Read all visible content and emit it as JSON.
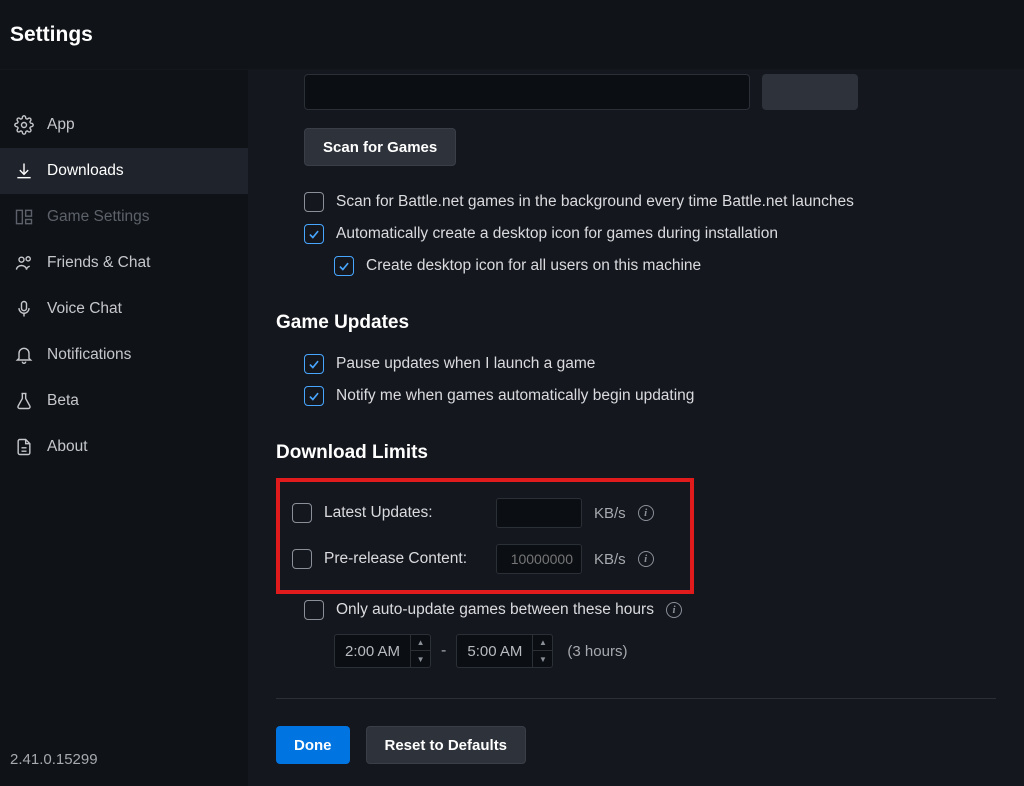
{
  "header": {
    "title": "Settings"
  },
  "sidebar": {
    "items": [
      {
        "label": "App"
      },
      {
        "label": "Downloads"
      },
      {
        "label": "Game Settings"
      },
      {
        "label": "Friends & Chat"
      },
      {
        "label": "Voice Chat"
      },
      {
        "label": "Notifications"
      },
      {
        "label": "Beta"
      },
      {
        "label": "About"
      }
    ],
    "version": "2.41.0.15299"
  },
  "scan": {
    "button": "Scan for Games",
    "background_label": "Scan for Battle.net games in the background every time Battle.net launches",
    "auto_icon_label": "Automatically create a desktop icon for games during installation",
    "all_users_label": "Create desktop icon for all users on this machine"
  },
  "updates": {
    "title": "Game Updates",
    "pause_label": "Pause updates when I launch a game",
    "notify_label": "Notify me when games automatically begin updating"
  },
  "limits": {
    "title": "Download Limits",
    "latest_label": "Latest Updates:",
    "latest_value": "",
    "pre_label": "Pre-release Content:",
    "pre_placeholder": "10000000",
    "unit": "KB/s",
    "hours_label": "Only auto-update games between these hours",
    "hours_from": "2:00 AM",
    "hours_to": "5:00 AM",
    "hours_duration": "(3 hours)"
  },
  "footer": {
    "done": "Done",
    "reset": "Reset to Defaults"
  }
}
